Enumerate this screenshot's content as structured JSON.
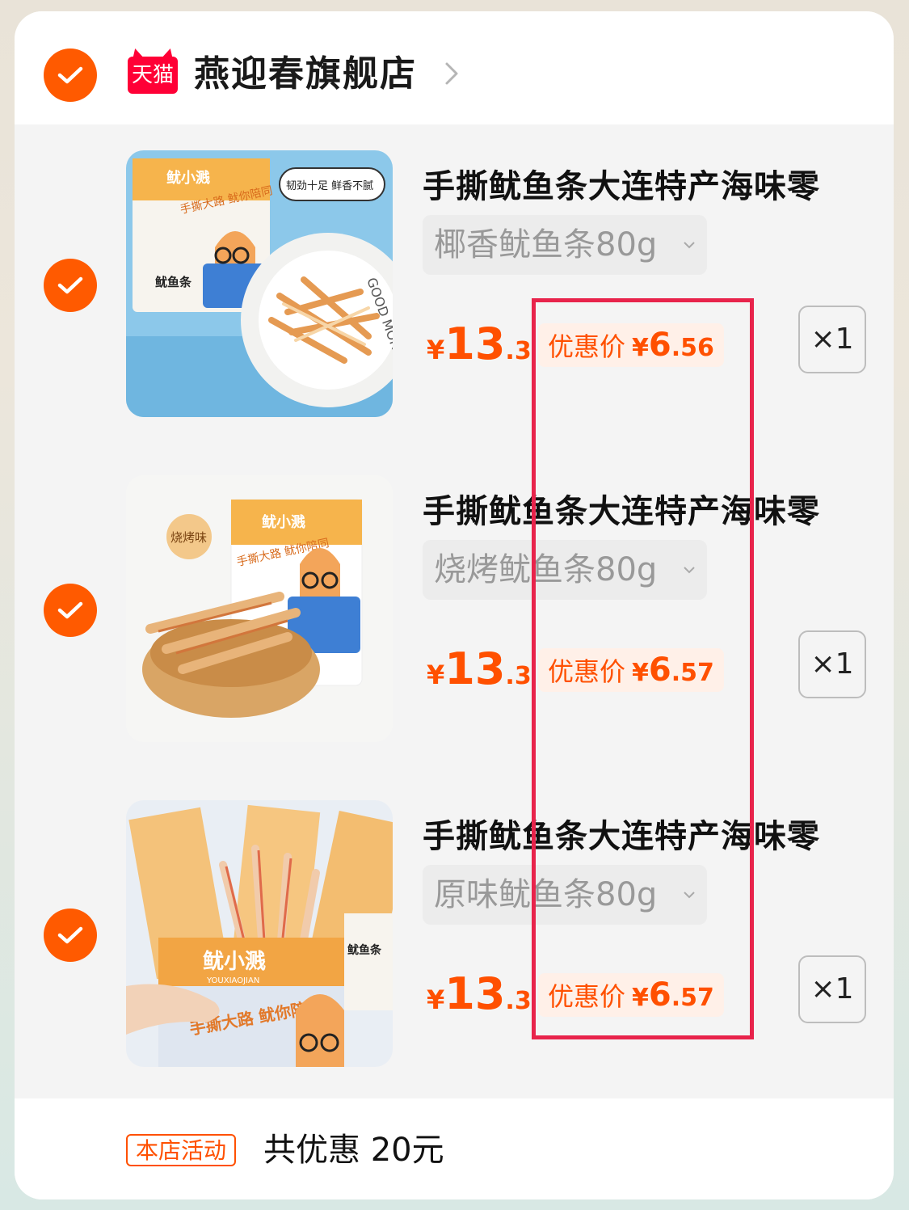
{
  "shop": {
    "platform_logo": "天猫",
    "name": "燕迎春旗舰店"
  },
  "items": [
    {
      "title": "手撕鱿鱼条大连特产海味零",
      "sku": "椰香鱿鱼条80g",
      "price_yen": "¥",
      "price_int": "13",
      "price_dec": ".3",
      "promo_label": "优惠价",
      "promo_yen": "¥",
      "promo_int": "6",
      "promo_dec": ".56",
      "qty": "×1",
      "image_texts": {
        "bag_brand": "鱿小溅",
        "bag_name": "鱿鱼条",
        "bag_slogan": "手撕大路 鱿你陪同",
        "tagline": "韧劲十足 鲜香不腻",
        "plate_text": "GOOD MORNING"
      }
    },
    {
      "title": "手撕鱿鱼条大连特产海味零",
      "sku": "烧烤鱿鱼条80g",
      "price_yen": "¥",
      "price_int": "13",
      "price_dec": ".3",
      "promo_label": "优惠价",
      "promo_yen": "¥",
      "promo_int": "6",
      "promo_dec": ".57",
      "qty": "×1",
      "image_texts": {
        "bag_brand": "鱿小溅",
        "flavor_badge": "烧烤味",
        "bag_slogan": "手撕大路 鱿你陪同"
      }
    },
    {
      "title": "手撕鱿鱼条大连特产海味零",
      "sku": "原味鱿鱼条80g",
      "price_yen": "¥",
      "price_int": "13",
      "price_dec": ".3",
      "promo_label": "优惠价",
      "promo_yen": "¥",
      "promo_int": "6",
      "promo_dec": ".57",
      "qty": "×1",
      "image_texts": {
        "bag_brand": "鱿小溅",
        "bag_sub": "YOUXIAOJIAN",
        "bag_name": "鱿鱼条",
        "bag_slogan": "手撕大路 鱿你陪同"
      }
    }
  ],
  "footer": {
    "activity_tag": "本店活动",
    "activity_text": "共优惠 20元"
  },
  "colors": {
    "accent": "#ff5000",
    "check": "#ff5a00",
    "tmall": "#ff0036",
    "highlight": "#e8234b"
  },
  "icons": {
    "select": "checkmark-icon",
    "shop_arrow": "chevron-right-icon",
    "sku_dropdown": "chevron-down-icon"
  }
}
